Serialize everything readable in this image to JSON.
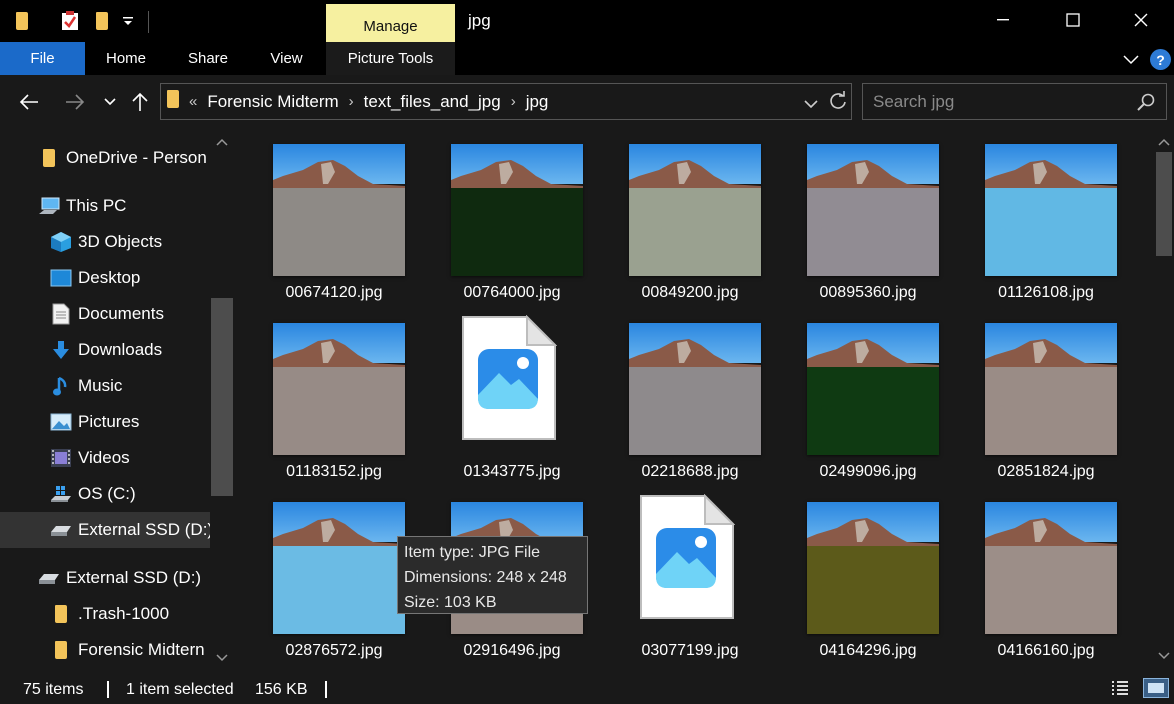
{
  "window": {
    "title": "jpg",
    "context_tab": "Manage",
    "controls": [
      "minimize",
      "maximize",
      "close"
    ]
  },
  "ribbon": {
    "tabs": [
      "File",
      "Home",
      "Share",
      "View",
      "Picture Tools"
    ],
    "help_label": "?"
  },
  "addressbar": {
    "overflow": "«",
    "crumbs": [
      "Forensic Midterm",
      "text_files_and_jpg",
      "jpg"
    ]
  },
  "search": {
    "placeholder": "Search jpg"
  },
  "sidebar": {
    "items": [
      {
        "label": "OneDrive - Person",
        "icon": "onedrive-folder-icon"
      },
      {
        "label": "This PC",
        "icon": "computer-icon"
      },
      {
        "label": "3D Objects",
        "icon": "cube-icon"
      },
      {
        "label": "Desktop",
        "icon": "desktop-icon"
      },
      {
        "label": "Documents",
        "icon": "document-icon"
      },
      {
        "label": "Downloads",
        "icon": "download-icon"
      },
      {
        "label": "Music",
        "icon": "music-note-icon"
      },
      {
        "label": "Pictures",
        "icon": "pictures-icon"
      },
      {
        "label": "Videos",
        "icon": "film-icon"
      },
      {
        "label": "OS (C:)",
        "icon": "windows-drive-icon"
      },
      {
        "label": "External SSD (D:)",
        "icon": "drive-icon"
      },
      {
        "label": "External SSD (D:)",
        "icon": "drive-icon"
      },
      {
        "label": ".Trash-1000",
        "icon": "folder-icon"
      },
      {
        "label": "Forensic Midtern",
        "icon": "folder-icon"
      }
    ]
  },
  "files": [
    {
      "name": "00674120.jpg",
      "ground": "#8e8a86"
    },
    {
      "name": "00764000.jpg",
      "ground": "#0f2a0f"
    },
    {
      "name": "00849200.jpg",
      "ground": "#9aa190"
    },
    {
      "name": "00895360.jpg",
      "ground": "#918c93"
    },
    {
      "name": "01126108.jpg",
      "ground": "#61b8e4"
    },
    {
      "name": "01183152.jpg",
      "ground": "#978b86"
    },
    {
      "name": "01343775.jpg",
      "ground": ""
    },
    {
      "name": "02218688.jpg",
      "ground": "#8e8a8c"
    },
    {
      "name": "02499096.jpg",
      "ground": "#0f3a12"
    },
    {
      "name": "02851824.jpg",
      "ground": "#9a8c86"
    },
    {
      "name": "02876572.jpg",
      "ground": "#6bbbe4"
    },
    {
      "name": "02916496.jpg",
      "ground": "#9a8c86"
    },
    {
      "name": "03077199.jpg",
      "ground": ""
    },
    {
      "name": "04164296.jpg",
      "ground": "#5c5a1a"
    },
    {
      "name": "04166160.jpg",
      "ground": "#9c8e88"
    }
  ],
  "tooltip": {
    "type": "Item type: JPG File",
    "dimensions": "Dimensions: 248 x 248",
    "size": "Size: 103 KB"
  },
  "status": {
    "count": "75 items",
    "selected": "1 item selected",
    "size": "156 KB"
  }
}
